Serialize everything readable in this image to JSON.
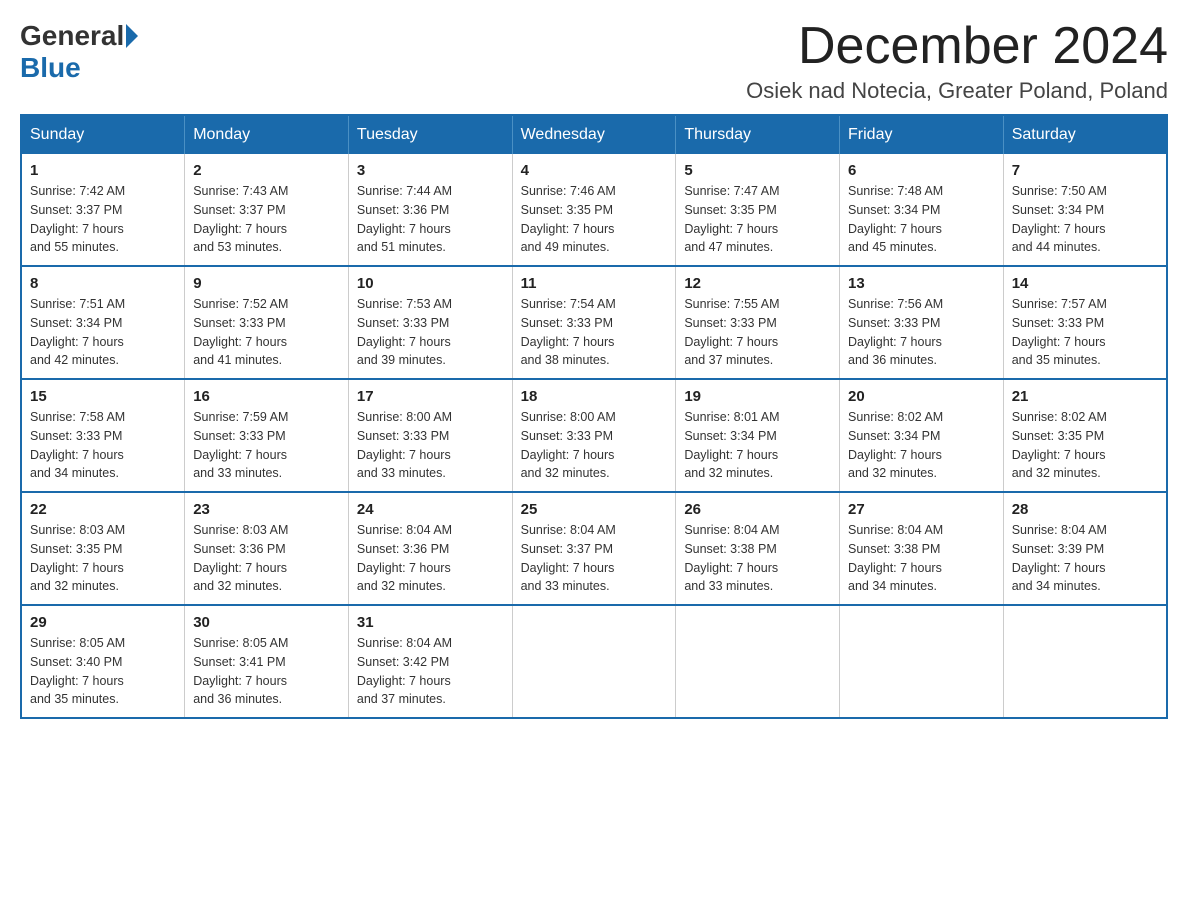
{
  "header": {
    "logo": {
      "general": "General",
      "blue": "Blue"
    },
    "title": "December 2024",
    "location": "Osiek nad Notecia, Greater Poland, Poland"
  },
  "days_of_week": [
    "Sunday",
    "Monday",
    "Tuesday",
    "Wednesday",
    "Thursday",
    "Friday",
    "Saturday"
  ],
  "weeks": [
    [
      {
        "day": "1",
        "sunrise": "7:42 AM",
        "sunset": "3:37 PM",
        "daylight": "7 hours and 55 minutes."
      },
      {
        "day": "2",
        "sunrise": "7:43 AM",
        "sunset": "3:37 PM",
        "daylight": "7 hours and 53 minutes."
      },
      {
        "day": "3",
        "sunrise": "7:44 AM",
        "sunset": "3:36 PM",
        "daylight": "7 hours and 51 minutes."
      },
      {
        "day": "4",
        "sunrise": "7:46 AM",
        "sunset": "3:35 PM",
        "daylight": "7 hours and 49 minutes."
      },
      {
        "day": "5",
        "sunrise": "7:47 AM",
        "sunset": "3:35 PM",
        "daylight": "7 hours and 47 minutes."
      },
      {
        "day": "6",
        "sunrise": "7:48 AM",
        "sunset": "3:34 PM",
        "daylight": "7 hours and 45 minutes."
      },
      {
        "day": "7",
        "sunrise": "7:50 AM",
        "sunset": "3:34 PM",
        "daylight": "7 hours and 44 minutes."
      }
    ],
    [
      {
        "day": "8",
        "sunrise": "7:51 AM",
        "sunset": "3:34 PM",
        "daylight": "7 hours and 42 minutes."
      },
      {
        "day": "9",
        "sunrise": "7:52 AM",
        "sunset": "3:33 PM",
        "daylight": "7 hours and 41 minutes."
      },
      {
        "day": "10",
        "sunrise": "7:53 AM",
        "sunset": "3:33 PM",
        "daylight": "7 hours and 39 minutes."
      },
      {
        "day": "11",
        "sunrise": "7:54 AM",
        "sunset": "3:33 PM",
        "daylight": "7 hours and 38 minutes."
      },
      {
        "day": "12",
        "sunrise": "7:55 AM",
        "sunset": "3:33 PM",
        "daylight": "7 hours and 37 minutes."
      },
      {
        "day": "13",
        "sunrise": "7:56 AM",
        "sunset": "3:33 PM",
        "daylight": "7 hours and 36 minutes."
      },
      {
        "day": "14",
        "sunrise": "7:57 AM",
        "sunset": "3:33 PM",
        "daylight": "7 hours and 35 minutes."
      }
    ],
    [
      {
        "day": "15",
        "sunrise": "7:58 AM",
        "sunset": "3:33 PM",
        "daylight": "7 hours and 34 minutes."
      },
      {
        "day": "16",
        "sunrise": "7:59 AM",
        "sunset": "3:33 PM",
        "daylight": "7 hours and 33 minutes."
      },
      {
        "day": "17",
        "sunrise": "8:00 AM",
        "sunset": "3:33 PM",
        "daylight": "7 hours and 33 minutes."
      },
      {
        "day": "18",
        "sunrise": "8:00 AM",
        "sunset": "3:33 PM",
        "daylight": "7 hours and 32 minutes."
      },
      {
        "day": "19",
        "sunrise": "8:01 AM",
        "sunset": "3:34 PM",
        "daylight": "7 hours and 32 minutes."
      },
      {
        "day": "20",
        "sunrise": "8:02 AM",
        "sunset": "3:34 PM",
        "daylight": "7 hours and 32 minutes."
      },
      {
        "day": "21",
        "sunrise": "8:02 AM",
        "sunset": "3:35 PM",
        "daylight": "7 hours and 32 minutes."
      }
    ],
    [
      {
        "day": "22",
        "sunrise": "8:03 AM",
        "sunset": "3:35 PM",
        "daylight": "7 hours and 32 minutes."
      },
      {
        "day": "23",
        "sunrise": "8:03 AM",
        "sunset": "3:36 PM",
        "daylight": "7 hours and 32 minutes."
      },
      {
        "day": "24",
        "sunrise": "8:04 AM",
        "sunset": "3:36 PM",
        "daylight": "7 hours and 32 minutes."
      },
      {
        "day": "25",
        "sunrise": "8:04 AM",
        "sunset": "3:37 PM",
        "daylight": "7 hours and 33 minutes."
      },
      {
        "day": "26",
        "sunrise": "8:04 AM",
        "sunset": "3:38 PM",
        "daylight": "7 hours and 33 minutes."
      },
      {
        "day": "27",
        "sunrise": "8:04 AM",
        "sunset": "3:38 PM",
        "daylight": "7 hours and 34 minutes."
      },
      {
        "day": "28",
        "sunrise": "8:04 AM",
        "sunset": "3:39 PM",
        "daylight": "7 hours and 34 minutes."
      }
    ],
    [
      {
        "day": "29",
        "sunrise": "8:05 AM",
        "sunset": "3:40 PM",
        "daylight": "7 hours and 35 minutes."
      },
      {
        "day": "30",
        "sunrise": "8:05 AM",
        "sunset": "3:41 PM",
        "daylight": "7 hours and 36 minutes."
      },
      {
        "day": "31",
        "sunrise": "8:04 AM",
        "sunset": "3:42 PM",
        "daylight": "7 hours and 37 minutes."
      },
      null,
      null,
      null,
      null
    ]
  ],
  "labels": {
    "sunrise": "Sunrise:",
    "sunset": "Sunset:",
    "daylight": "Daylight:"
  },
  "colors": {
    "header_bg": "#1a6aab",
    "border": "#1a6aab"
  }
}
